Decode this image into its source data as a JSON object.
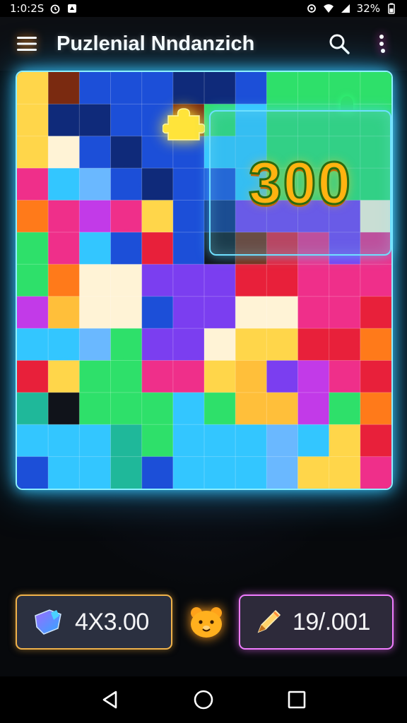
{
  "status_bar": {
    "time": "1:0:2S",
    "battery": "32%",
    "icons": [
      "alarm-icon",
      "notification-icon",
      "sync-icon",
      "wifi-icon",
      "signal-icon",
      "battery-icon"
    ]
  },
  "app_bar": {
    "title": "Puzlenial Nndanzich",
    "icons": [
      "menu-icon",
      "search-icon",
      "more-vert-icon"
    ]
  },
  "game": {
    "score": "300",
    "colors": {
      "board_border": "#8ef0ff",
      "score_text": "#ffb310",
      "left_stat_border": "#f0b24a",
      "right_stat_border": "#f07cff"
    },
    "puzzle_colors": [
      "#ffd64a",
      "#1c4fd8",
      "#ef2f8a",
      "#2ee06a",
      "#7b3ef0",
      "#ff7a1a",
      "#33c6ff",
      "#ffffff"
    ]
  },
  "stats": {
    "left": {
      "icon": "puzzle-piece-icon",
      "value": "4X3.00"
    },
    "center": {
      "icon": "bear-mascot-icon"
    },
    "right": {
      "icon": "pencil-icon",
      "value": "19/.001"
    }
  },
  "nav_bar": {
    "icons": [
      "back-icon",
      "home-icon",
      "recents-icon"
    ]
  }
}
